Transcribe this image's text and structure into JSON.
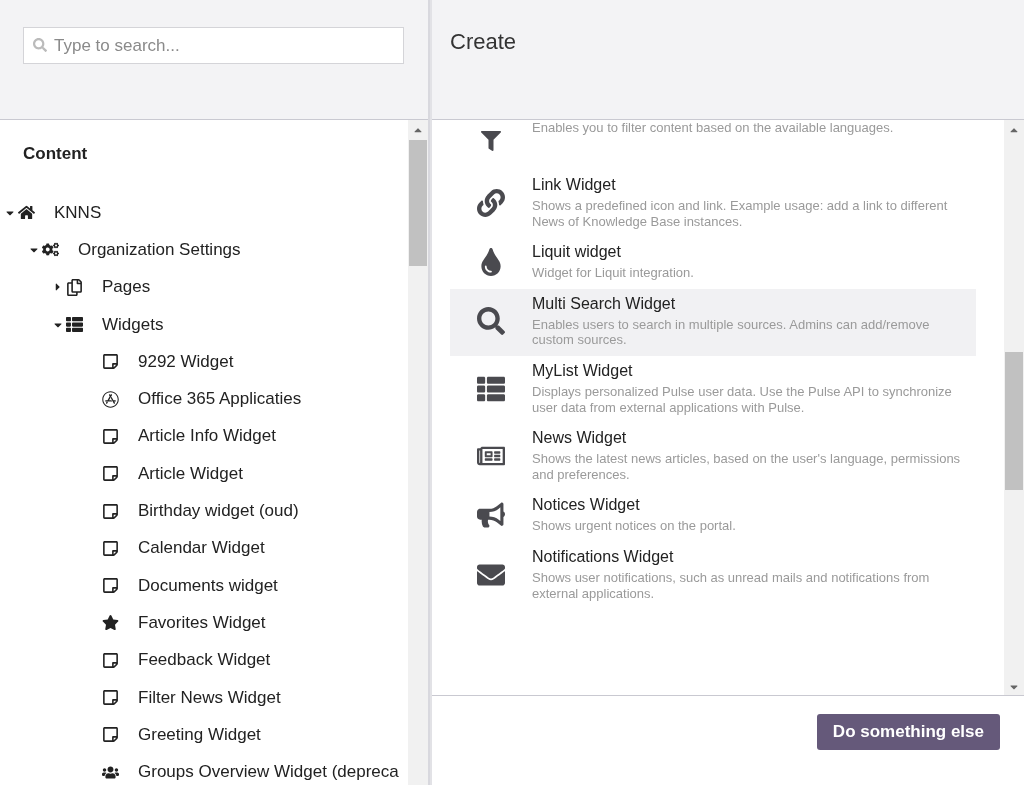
{
  "search": {
    "placeholder": "Type to search..."
  },
  "tree": {
    "title": "Content",
    "items": [
      {
        "label": "KNNS",
        "kind": "home",
        "expanded": true,
        "children": [
          {
            "label": "Organization Settings",
            "kind": "cogs",
            "expanded": true,
            "children": [
              {
                "label": "Pages",
                "kind": "pages",
                "expanded": false
              },
              {
                "label": "Widgets",
                "kind": "list",
                "expanded": true,
                "children": [
                  {
                    "label": "9292 Widget",
                    "kind": "note"
                  },
                  {
                    "label": "Office 365 Applicaties",
                    "kind": "apps"
                  },
                  {
                    "label": "Article Info Widget",
                    "kind": "note"
                  },
                  {
                    "label": "Article Widget",
                    "kind": "note"
                  },
                  {
                    "label": "Birthday widget (oud)",
                    "kind": "note"
                  },
                  {
                    "label": "Calendar Widget",
                    "kind": "note"
                  },
                  {
                    "label": "Documents widget",
                    "kind": "note"
                  },
                  {
                    "label": "Favorites Widget",
                    "kind": "star"
                  },
                  {
                    "label": "Feedback Widget",
                    "kind": "note"
                  },
                  {
                    "label": "Filter News Widget",
                    "kind": "note"
                  },
                  {
                    "label": "Greeting Widget",
                    "kind": "note"
                  },
                  {
                    "label": "Groups Overview Widget (depreca",
                    "kind": "group"
                  }
                ]
              }
            ]
          }
        ]
      }
    ]
  },
  "create": {
    "title": "Create",
    "items": [
      {
        "kind": "filter",
        "description": "Enables you to filter content based on the available languages.",
        "selected": false
      },
      {
        "kind": "link",
        "title": "Link Widget",
        "description": "Shows a predefined icon and link. Example usage: add a link to different News of Knowledge Base instances.",
        "selected": false
      },
      {
        "kind": "drop",
        "title": "Liquit widget",
        "description": "Widget for Liquit integration.",
        "selected": false
      },
      {
        "kind": "search",
        "title": "Multi Search Widget",
        "description": "Enables users to search in multiple sources. Admins can add/remove custom sources.",
        "selected": true
      },
      {
        "kind": "list",
        "title": "MyList Widget",
        "description": "Displays personalized Pulse user data. Use the Pulse API to synchronize user data from external applications with Pulse.",
        "selected": false
      },
      {
        "kind": "news",
        "title": "News Widget",
        "description": "Shows the latest news articles, based on the user's language, permissions and preferences.",
        "selected": false
      },
      {
        "kind": "megaphone",
        "title": "Notices Widget",
        "description": "Shows urgent notices on the portal.",
        "selected": false
      },
      {
        "kind": "envelope",
        "title": "Notifications Widget",
        "description": "Shows user notifications, such as unread mails and notifications from external applications.",
        "selected": false
      }
    ]
  },
  "footer": {
    "button": "Do something else"
  }
}
